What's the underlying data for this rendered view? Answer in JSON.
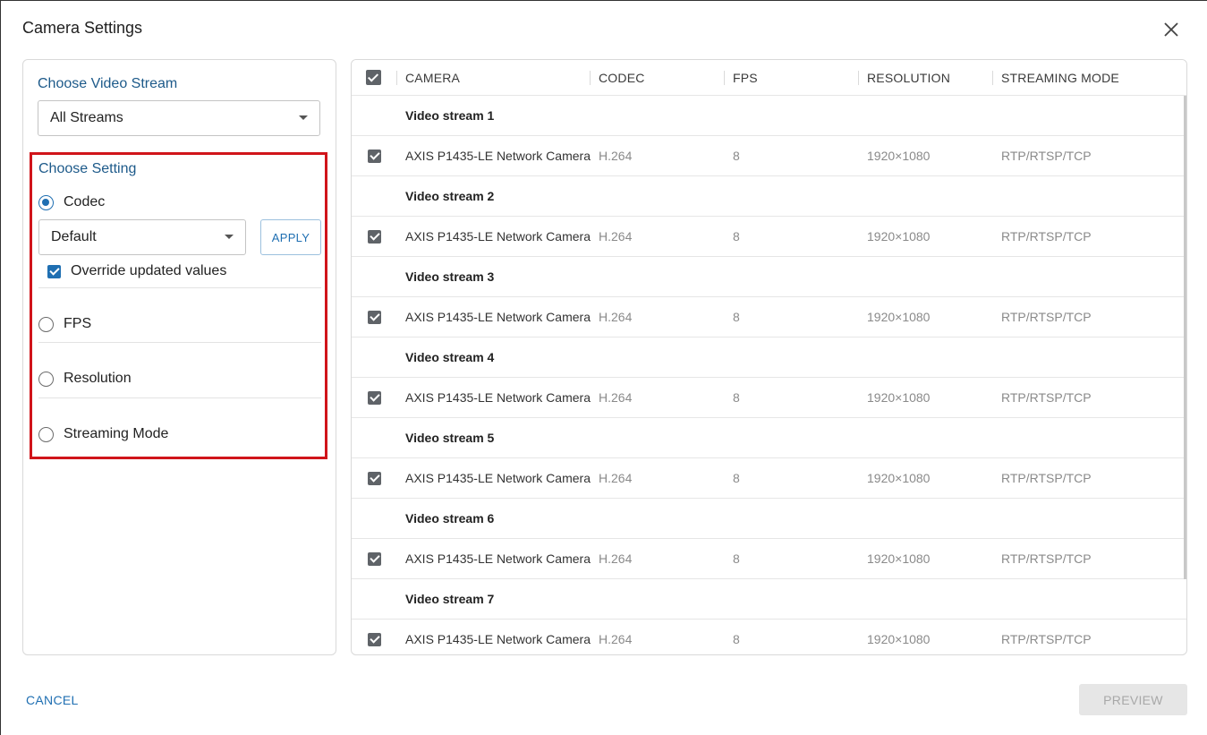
{
  "dialog": {
    "title": "Camera Settings"
  },
  "left": {
    "stream_label": "Choose Video Stream",
    "stream_select_value": "All Streams",
    "setting_label": "Choose Setting",
    "options": [
      {
        "label": "Codec",
        "selected": true
      },
      {
        "label": "FPS",
        "selected": false
      },
      {
        "label": "Resolution",
        "selected": false
      },
      {
        "label": "Streaming Mode",
        "selected": false
      }
    ],
    "codec_select_value": "Default",
    "apply_label": "APPLY",
    "override_label": "Override updated values"
  },
  "table": {
    "headers": {
      "camera": "CAMERA",
      "codec": "CODEC",
      "fps": "FPS",
      "resolution": "RESOLUTION",
      "mode": "STREAMING MODE"
    },
    "groups": [
      {
        "name": "Video stream 1",
        "row": {
          "camera": "AXIS P1435-LE Network Camera",
          "codec": "H.264",
          "fps": "8",
          "resolution": "1920×1080",
          "mode": "RTP/RTSP/TCP"
        }
      },
      {
        "name": "Video stream 2",
        "row": {
          "camera": "AXIS P1435-LE Network Camera",
          "codec": "H.264",
          "fps": "8",
          "resolution": "1920×1080",
          "mode": "RTP/RTSP/TCP"
        }
      },
      {
        "name": "Video stream 3",
        "row": {
          "camera": "AXIS P1435-LE Network Camera",
          "codec": "H.264",
          "fps": "8",
          "resolution": "1920×1080",
          "mode": "RTP/RTSP/TCP"
        }
      },
      {
        "name": "Video stream 4",
        "row": {
          "camera": "AXIS P1435-LE Network Camera",
          "codec": "H.264",
          "fps": "8",
          "resolution": "1920×1080",
          "mode": "RTP/RTSP/TCP"
        }
      },
      {
        "name": "Video stream 5",
        "row": {
          "camera": "AXIS P1435-LE Network Camera",
          "codec": "H.264",
          "fps": "8",
          "resolution": "1920×1080",
          "mode": "RTP/RTSP/TCP"
        }
      },
      {
        "name": "Video stream 6",
        "row": {
          "camera": "AXIS P1435-LE Network Camera",
          "codec": "H.264",
          "fps": "8",
          "resolution": "1920×1080",
          "mode": "RTP/RTSP/TCP"
        }
      },
      {
        "name": "Video stream 7",
        "row": {
          "camera": "AXIS P1435-LE Network Camera",
          "codec": "H.264",
          "fps": "8",
          "resolution": "1920×1080",
          "mode": "RTP/RTSP/TCP"
        }
      }
    ]
  },
  "footer": {
    "cancel_label": "CANCEL",
    "preview_label": "PREVIEW"
  },
  "colors": {
    "accent": "#1f6fb2",
    "highlight_border": "#d0141a"
  }
}
